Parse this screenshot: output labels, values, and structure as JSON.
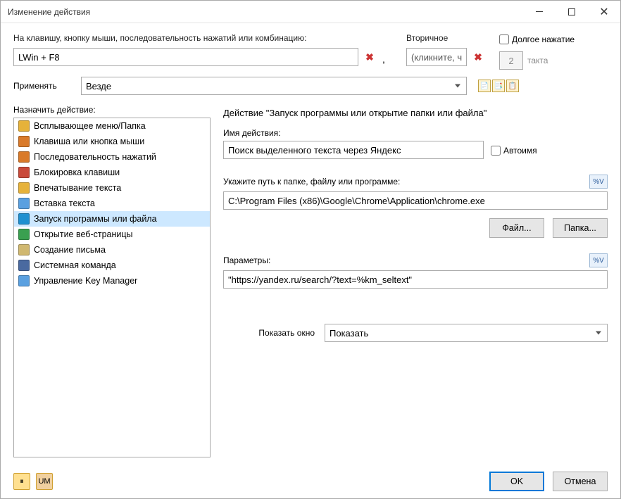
{
  "window": {
    "title": "Изменение действия"
  },
  "top": {
    "primaryLabel": "На клавишу, кнопку мыши, последовательность нажатий или комбинацию:",
    "primaryValue": "LWin + F8",
    "secondaryLabel": "Вторичное",
    "secondaryValue": "(кликните, ч",
    "longPressLabel": "Долгое нажатие",
    "taktValue": "2",
    "taktLabel": "такта"
  },
  "apply": {
    "label": "Применять",
    "value": "Везде"
  },
  "listLabel": "Назначить действие:",
  "actions": [
    {
      "label": "Всплывающее меню/Папка",
      "iconColor": "#e6b23a"
    },
    {
      "label": "Клавиша или кнопка мыши",
      "iconColor": "#d97a2a"
    },
    {
      "label": "Последовательность нажатий",
      "iconColor": "#d97a2a"
    },
    {
      "label": "Блокировка клавиши",
      "iconColor": "#c94a3a"
    },
    {
      "label": "Впечатывание текста",
      "iconColor": "#e6b23a"
    },
    {
      "label": "Вставка текста",
      "iconColor": "#5aa0e0"
    },
    {
      "label": "Запуск программы или файла",
      "iconColor": "#1e90d0",
      "selected": true
    },
    {
      "label": "Открытие веб-страницы",
      "iconColor": "#3aa050"
    },
    {
      "label": "Создание письма",
      "iconColor": "#d0b870"
    },
    {
      "label": "Системная команда",
      "iconColor": "#4a6aa0"
    },
    {
      "label": "Управление Key Manager",
      "iconColor": "#5aa0e0"
    }
  ],
  "right": {
    "header": "Действие \"Запуск программы или открытие папки или файла\"",
    "nameLabel": "Имя действия:",
    "nameValue": "Поиск выделенного текста через Яндекс",
    "autoNameLabel": "Автоимя",
    "pathLabel": "Укажите путь к папке, файлу или программе:",
    "pathValue": "C:\\Program Files (x86)\\Google\\Chrome\\Application\\chrome.exe",
    "fileBtn": "Файл...",
    "folderBtn": "Папка...",
    "paramsLabel": "Параметры:",
    "paramsValue": "\"https://yandex.ru/search/?text=%km_seltext\"",
    "showLabel": "Показать окно",
    "showValue": "Показать",
    "pctLabel": "%V"
  },
  "buttons": {
    "ok": "OK",
    "cancel": "Отмена"
  }
}
